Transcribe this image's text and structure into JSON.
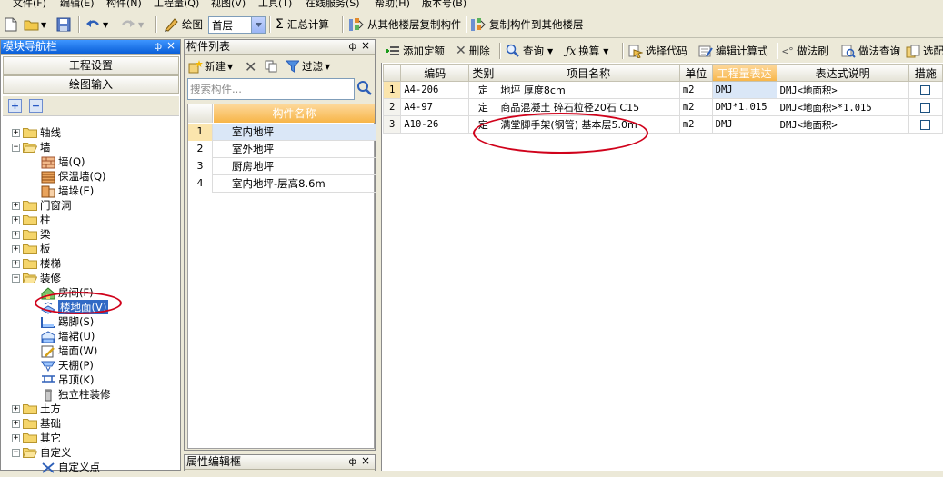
{
  "menu": [
    "文件(F)",
    "编辑(E)",
    "构件(N)",
    "工程量(Q)",
    "视图(V)",
    "工具(T)",
    "在线服务(S)",
    "帮助(H)",
    "版本号(B)"
  ],
  "toolbar": {
    "draw_label": "绘图",
    "floor_value": "首层",
    "sum_label": "汇总计算",
    "copy_from_label": "从其他楼层复制构件",
    "copy_to_label": "复制构件到其他楼层"
  },
  "nav_panel": {
    "title": "模块导航栏",
    "pin": "ф",
    "close": "×",
    "btn_settings": "工程设置",
    "btn_drawing": "绘图输入",
    "add": "+",
    "remove": "−",
    "tree": [
      {
        "label": "轴线",
        "level": 0,
        "expanded": false,
        "icon": "folder-icon"
      },
      {
        "label": "墙",
        "level": 0,
        "expanded": true,
        "icon": "folder-open-icon"
      },
      {
        "label": "墙(Q)",
        "level": 1,
        "icon": "wall-icon"
      },
      {
        "label": "保温墙(Q)",
        "level": 1,
        "icon": "insulation-wall-icon"
      },
      {
        "label": "墙垛(E)",
        "level": 1,
        "icon": "wall-pier-icon"
      },
      {
        "label": "门窗洞",
        "level": 0,
        "expanded": false,
        "icon": "folder-icon"
      },
      {
        "label": "柱",
        "level": 0,
        "expanded": false,
        "icon": "folder-icon"
      },
      {
        "label": "梁",
        "level": 0,
        "expanded": false,
        "icon": "folder-icon"
      },
      {
        "label": "板",
        "level": 0,
        "expanded": false,
        "icon": "folder-icon"
      },
      {
        "label": "楼梯",
        "level": 0,
        "expanded": false,
        "icon": "folder-icon"
      },
      {
        "label": "装修",
        "level": 0,
        "expanded": true,
        "icon": "folder-open-icon"
      },
      {
        "label": "房间(F)",
        "level": 1,
        "icon": "room-icon"
      },
      {
        "label": "楼地面(V)",
        "level": 1,
        "icon": "floor-icon",
        "selected": true
      },
      {
        "label": "踢脚(S)",
        "level": 1,
        "icon": "skirting-icon"
      },
      {
        "label": "墙裙(U)",
        "level": 1,
        "icon": "dado-icon"
      },
      {
        "label": "墙面(W)",
        "level": 1,
        "icon": "wall-surface-icon"
      },
      {
        "label": "天棚(P)",
        "level": 1,
        "icon": "ceiling-icon"
      },
      {
        "label": "吊顶(K)",
        "level": 1,
        "icon": "suspended-ceiling-icon"
      },
      {
        "label": "独立柱装修",
        "level": 1,
        "icon": "column-finish-icon"
      },
      {
        "label": "土方",
        "level": 0,
        "expanded": false,
        "icon": "folder-icon"
      },
      {
        "label": "基础",
        "level": 0,
        "expanded": false,
        "icon": "folder-icon"
      },
      {
        "label": "其它",
        "level": 0,
        "expanded": false,
        "icon": "folder-icon"
      },
      {
        "label": "自定义",
        "level": 0,
        "expanded": true,
        "icon": "folder-open-icon"
      },
      {
        "label": "自定义点",
        "level": 1,
        "icon": "custom-point-icon"
      }
    ]
  },
  "comp_panel": {
    "title": "构件列表",
    "new_label": "新建",
    "filter_label": "过滤",
    "search_placeholder": "搜索构件...",
    "col_name": "构件名称",
    "rows": [
      {
        "num": "1",
        "name": "室内地坪"
      },
      {
        "num": "2",
        "name": "室外地坪"
      },
      {
        "num": "3",
        "name": "厨房地坪"
      },
      {
        "num": "4",
        "name": "室内地坪-层高8.6m"
      }
    ],
    "prop_title": "属性编辑框"
  },
  "right_toolbar": {
    "add_quota": "添加定额",
    "delete": "删除",
    "query": "查询",
    "convert": "换算",
    "select_code": "选择代码",
    "edit_formula": "编辑计算式",
    "method_brush": "做法刷",
    "method_query": "做法查询",
    "select_more": "选配"
  },
  "table": {
    "headers": [
      "编码",
      "类别",
      "项目名称",
      "单位",
      "工程量表达",
      "表达式说明",
      "措施"
    ],
    "rows": [
      {
        "num": "1",
        "code": "A4-206",
        "cat": "定",
        "name": "地坪 厚度8cm",
        "unit": "m2",
        "expr": "DMJ",
        "desc": "DMJ<地面积>"
      },
      {
        "num": "2",
        "code": "A4-97",
        "cat": "定",
        "name": "商品混凝土 碎石粒径20石 C15",
        "unit": "m2",
        "expr": "DMJ*1.015",
        "desc": "DMJ<地面积>*1.015"
      },
      {
        "num": "3",
        "code": "A10-26",
        "cat": "定",
        "name": "满堂脚手架(钢管) 基本层5.0m",
        "unit": "m2",
        "expr": "DMJ",
        "desc": "DMJ<地面积>"
      }
    ]
  },
  "colors": {
    "highlight": "#d0021b",
    "selection": "#316ac5",
    "header_orange": "#f7b548"
  }
}
